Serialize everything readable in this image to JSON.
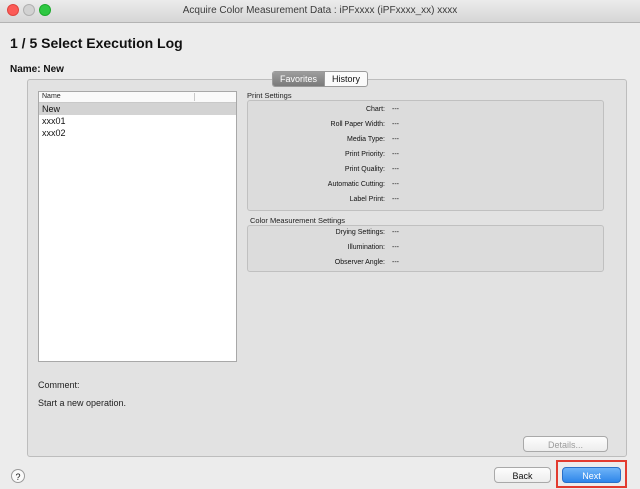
{
  "window": {
    "title": "Acquire Color Measurement Data : iPFxxxx (iPFxxxx_xx) xxxx"
  },
  "step_title": "1 / 5 Select Execution Log",
  "name_line": "Name: New",
  "tabs": [
    {
      "label": "Favorites",
      "active": true
    },
    {
      "label": "History",
      "active": false
    }
  ],
  "list": {
    "header": "Name",
    "items": [
      {
        "label": "New",
        "selected": true
      },
      {
        "label": "xxx01",
        "selected": false
      },
      {
        "label": "xxx02",
        "selected": false
      }
    ]
  },
  "print_settings": {
    "title": "Print Settings",
    "rows": [
      {
        "label": "Chart:",
        "value": "---"
      },
      {
        "label": "Roll Paper Width:",
        "value": "---"
      },
      {
        "label": "Media Type:",
        "value": "---"
      },
      {
        "label": "Print Priority:",
        "value": "---"
      },
      {
        "label": "Print Quality:",
        "value": "---"
      },
      {
        "label": "Automatic Cutting:",
        "value": "---"
      },
      {
        "label": "Label Print:",
        "value": "---"
      }
    ]
  },
  "color_settings": {
    "title": "Color Measurement Settings",
    "rows": [
      {
        "label": "Drying Settings:",
        "value": "---"
      },
      {
        "label": "Illumination:",
        "value": "---"
      },
      {
        "label": "Observer Angle:",
        "value": "---"
      }
    ]
  },
  "comment": {
    "label": "Comment:",
    "text": "Start a new operation."
  },
  "buttons": {
    "details": "Details...",
    "back": "Back",
    "next": "Next",
    "help": "?"
  }
}
